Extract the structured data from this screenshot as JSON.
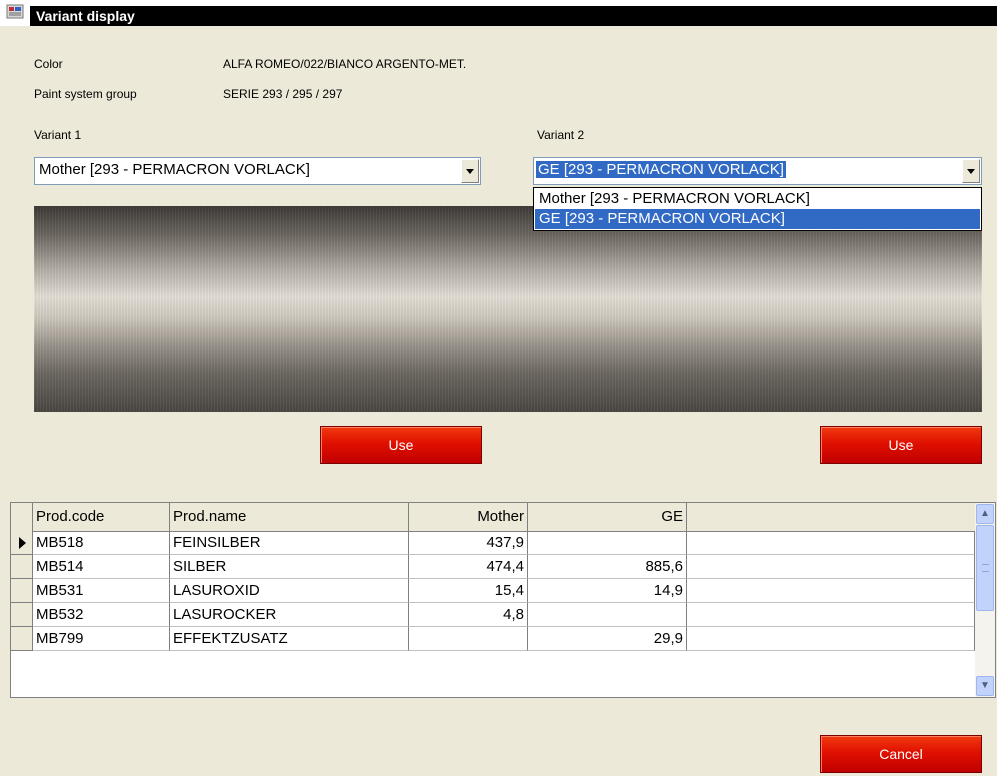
{
  "window": {
    "title": "Variant display"
  },
  "info": {
    "color_label": "Color",
    "color_value": "ALFA ROMEO/022/BIANCO ARGENTO-MET.",
    "paint_label": "Paint system group",
    "paint_value": "SERIE 293 / 295 / 297"
  },
  "variant1": {
    "label": "Variant 1",
    "selected": "Mother [293 - PERMACRON VORLACK]",
    "use_label": "Use"
  },
  "variant2": {
    "label": "Variant 2",
    "selected": "GE [293 - PERMACRON VORLACK]",
    "options": [
      "Mother [293 - PERMACRON VORLACK]",
      "GE [293 - PERMACRON VORLACK]"
    ],
    "highlighted_index": 1,
    "use_label": "Use"
  },
  "table": {
    "headers": [
      "Prod.code",
      "Prod.name",
      "Mother",
      "GE",
      ""
    ],
    "current_row": 0,
    "rows": [
      [
        "MB518",
        "FEINSILBER",
        "437,9",
        ""
      ],
      [
        "MB514",
        "SILBER",
        "474,4",
        "885,6"
      ],
      [
        "MB531",
        "LASUROXID",
        "15,4",
        "14,9"
      ],
      [
        "MB532",
        "LASUROCKER",
        "4,8",
        ""
      ],
      [
        "MB799",
        "EFFEKTZUSATZ",
        "",
        "29,9"
      ]
    ]
  },
  "footer": {
    "cancel_label": "Cancel"
  },
  "colors": {
    "accent": "#e01000",
    "selection": "#316ac5",
    "window_bg": "#ece9d8"
  }
}
